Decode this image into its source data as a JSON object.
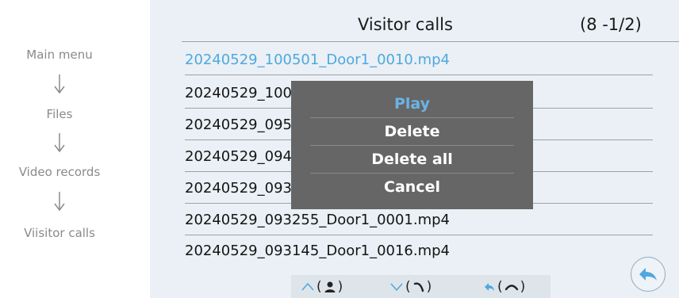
{
  "flow": {
    "steps": [
      "Main menu",
      "Files",
      "Video records",
      "Viisitor calls"
    ]
  },
  "header": {
    "title": "Visitor calls",
    "page_indicator": "(8 -1/2)"
  },
  "files": [
    {
      "name": "20240529_100501_Door1_0010.mp4",
      "selected": true
    },
    {
      "name": "20240529_100",
      "selected": false
    },
    {
      "name": "20240529_095",
      "selected": false
    },
    {
      "name": "20240529_094",
      "selected": false
    },
    {
      "name": "20240529_093",
      "selected": false
    },
    {
      "name": "20240529_093255_Door1_0001.mp4",
      "selected": false
    },
    {
      "name": "20240529_093145_Door1_0016.mp4",
      "selected": false
    }
  ],
  "popup": {
    "items": [
      "Play",
      "Delete",
      "Delete all",
      "Cancel"
    ],
    "active_index": 0
  },
  "bottom_nav": {
    "groups": [
      {
        "arrow_icon": "chevron-up-icon",
        "action_icon": "person-icon"
      },
      {
        "arrow_icon": "chevron-down-icon",
        "action_icon": "answer-call-icon"
      },
      {
        "arrow_icon": "back-arrow-icon",
        "action_icon": "hangup-icon"
      }
    ]
  },
  "colors": {
    "screen_bg": "#eaf0f5",
    "selected_text": "#4fa8df",
    "popup_bg": "#666666",
    "popup_active": "#6cb4e4",
    "flow_text": "#8a8a8a"
  }
}
